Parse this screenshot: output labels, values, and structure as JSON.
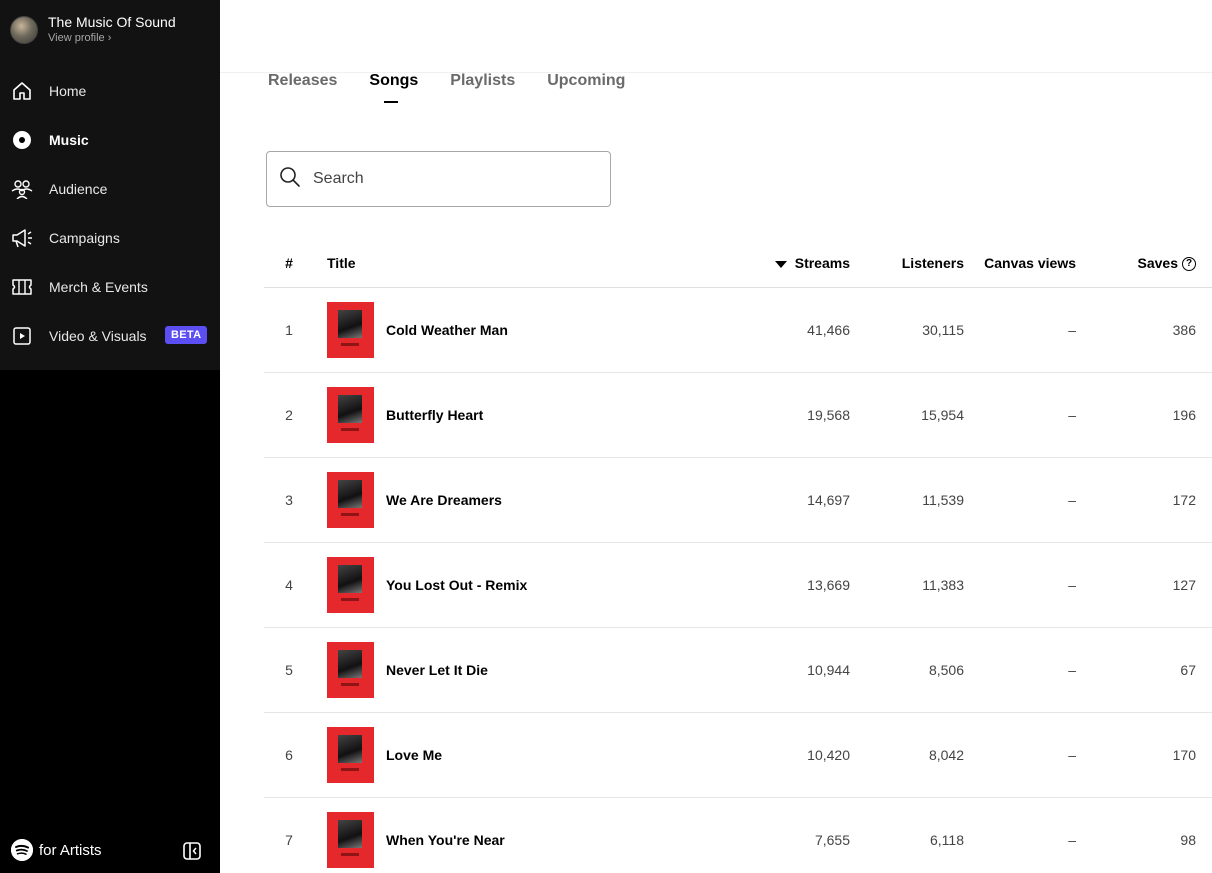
{
  "profile": {
    "name": "The Music Of Sound",
    "link": "View profile ›"
  },
  "nav": [
    {
      "label": "Home",
      "icon": "home-icon"
    },
    {
      "label": "Music",
      "icon": "music-icon",
      "active": true
    },
    {
      "label": "Audience",
      "icon": "audience-icon"
    },
    {
      "label": "Campaigns",
      "icon": "megaphone-icon"
    },
    {
      "label": "Merch & Events",
      "icon": "ticket-icon"
    },
    {
      "label": "Video & Visuals",
      "icon": "video-icon",
      "badge": "BETA"
    }
  ],
  "brand": {
    "label": "for Artists"
  },
  "tabs": [
    {
      "label": "Releases"
    },
    {
      "label": "Songs",
      "active": true
    },
    {
      "label": "Playlists"
    },
    {
      "label": "Upcoming"
    }
  ],
  "search": {
    "placeholder": "Search",
    "value": ""
  },
  "table": {
    "headers": {
      "num": "#",
      "title": "Title",
      "streams": "Streams",
      "listeners": "Listeners",
      "canvas": "Canvas views",
      "saves": "Saves",
      "help_glyph": "?"
    },
    "rows": [
      {
        "num": "1",
        "title": "Cold Weather Man",
        "streams": "41,466",
        "listeners": "30,115",
        "canvas": "–",
        "saves": "386"
      },
      {
        "num": "2",
        "title": "Butterfly Heart",
        "streams": "19,568",
        "listeners": "15,954",
        "canvas": "–",
        "saves": "196"
      },
      {
        "num": "3",
        "title": "We Are Dreamers",
        "streams": "14,697",
        "listeners": "11,539",
        "canvas": "–",
        "saves": "172"
      },
      {
        "num": "4",
        "title": "You Lost Out - Remix",
        "streams": "13,669",
        "listeners": "11,383",
        "canvas": "–",
        "saves": "127"
      },
      {
        "num": "5",
        "title": "Never Let It Die",
        "streams": "10,944",
        "listeners": "8,506",
        "canvas": "–",
        "saves": "67"
      },
      {
        "num": "6",
        "title": "Love Me",
        "streams": "10,420",
        "listeners": "8,042",
        "canvas": "–",
        "saves": "170"
      },
      {
        "num": "7",
        "title": "When You're Near",
        "streams": "7,655",
        "listeners": "6,118",
        "canvas": "–",
        "saves": "98"
      }
    ]
  },
  "colors": {
    "sidebar": "#000000",
    "beta_badge": "#5b4ef2",
    "cover_art": "#e4282b"
  }
}
